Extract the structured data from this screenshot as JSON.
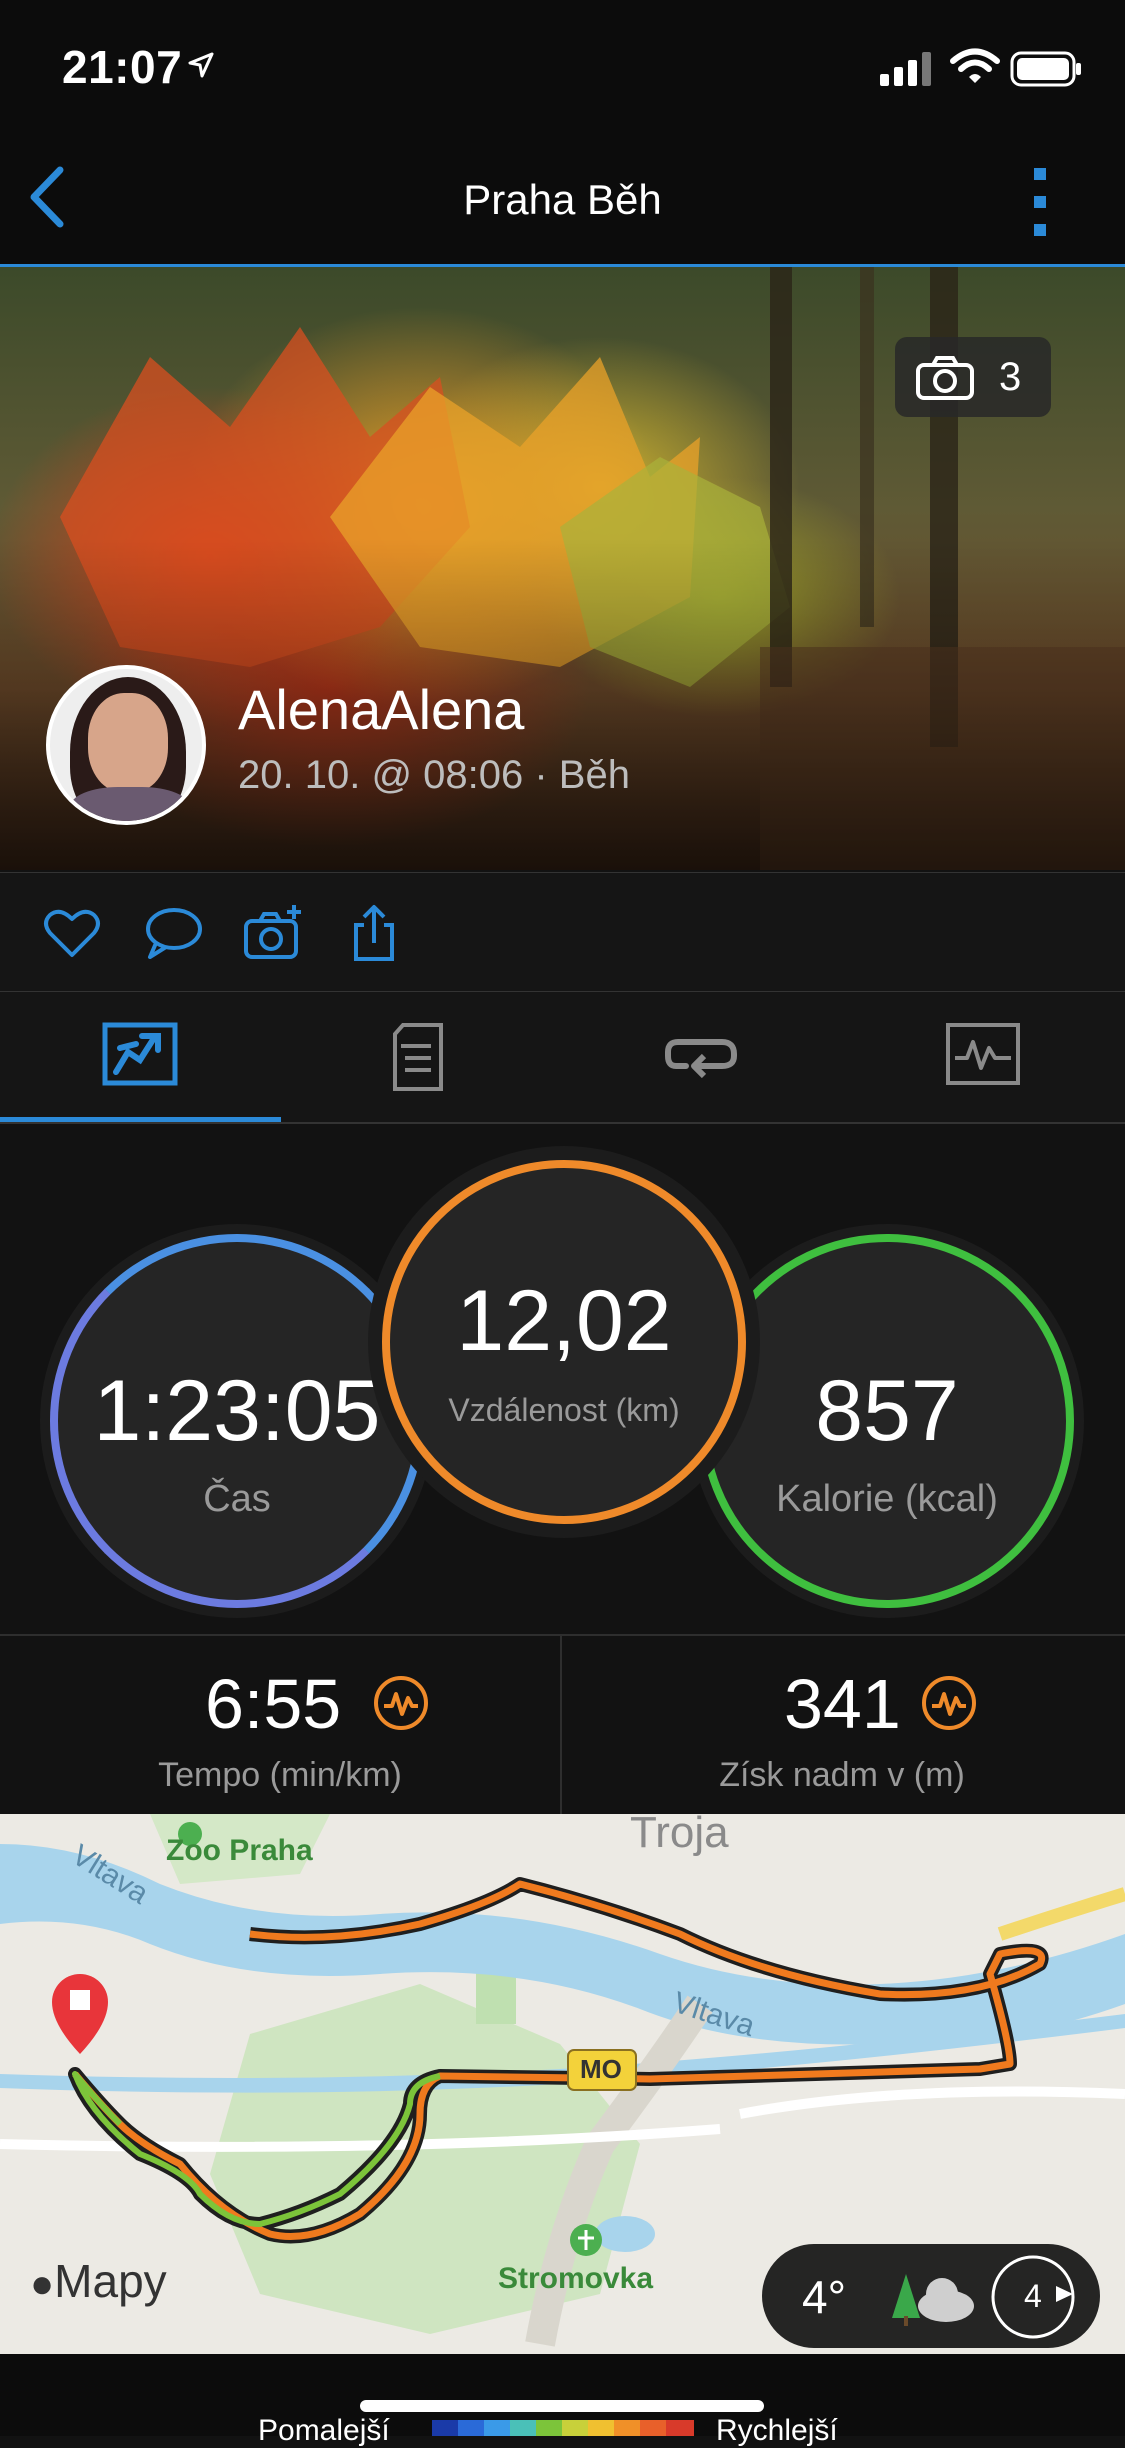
{
  "status_bar": {
    "time": "21:07"
  },
  "nav": {
    "title": "Praha Běh"
  },
  "hero": {
    "photo_count": "3",
    "user_name": "AlenaAlena",
    "meta": "20. 10. @ 08:06 · Běh"
  },
  "actions": [
    "heart-icon",
    "comment-icon",
    "add-photo-icon",
    "share-icon"
  ],
  "tabs": [
    {
      "icon": "summary-icon",
      "active": true
    },
    {
      "icon": "details-icon",
      "active": false
    },
    {
      "icon": "laps-icon",
      "active": false
    },
    {
      "icon": "charts-icon",
      "active": false
    }
  ],
  "stats": {
    "time": {
      "value": "1:23:05",
      "label": "Čas"
    },
    "distance": {
      "value": "12,02",
      "label": "Vzdálenost (km)"
    },
    "calories": {
      "value": "857",
      "label": "Kalorie (kcal)"
    }
  },
  "secondary": {
    "pace": {
      "value": "6:55",
      "label": "Tempo (min/km)"
    },
    "elevation": {
      "value": "341",
      "label": "Získ nadm v (m)"
    }
  },
  "map": {
    "labels": {
      "troja": "Troja",
      "zoo": "Zoo Praha",
      "vltava1": "Vltava",
      "vltava2": "Vltava",
      "mo": "MO",
      "stromovka": "Stromovka"
    },
    "brand": "Mapy",
    "weather": {
      "temp": "4°",
      "wind": "4"
    }
  },
  "legend": {
    "slow": "Pomalejší",
    "fast": "Rychlejší"
  },
  "colors": {
    "accent": "#2b8ad8",
    "distance": "#ef8a2a",
    "calories": "#3fbf3f",
    "time": "#6c7be0"
  }
}
